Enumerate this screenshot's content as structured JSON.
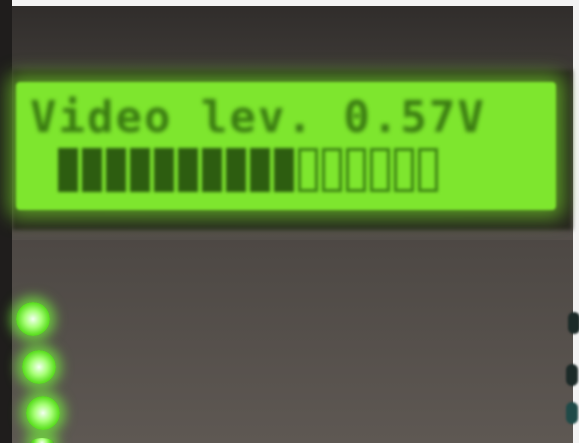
{
  "lcd": {
    "line1": "Video lev. 0.57V",
    "bar_level": {
      "filled": 10,
      "total": 16
    }
  },
  "leds": [
    {
      "label": ""
    },
    {
      "label": ""
    },
    {
      "label": ""
    }
  ],
  "colors": {
    "lcd_background": "#7ee62e",
    "lcd_text": "#3a7a12",
    "led_green": "#5fe025",
    "panel": "#5a5450"
  }
}
